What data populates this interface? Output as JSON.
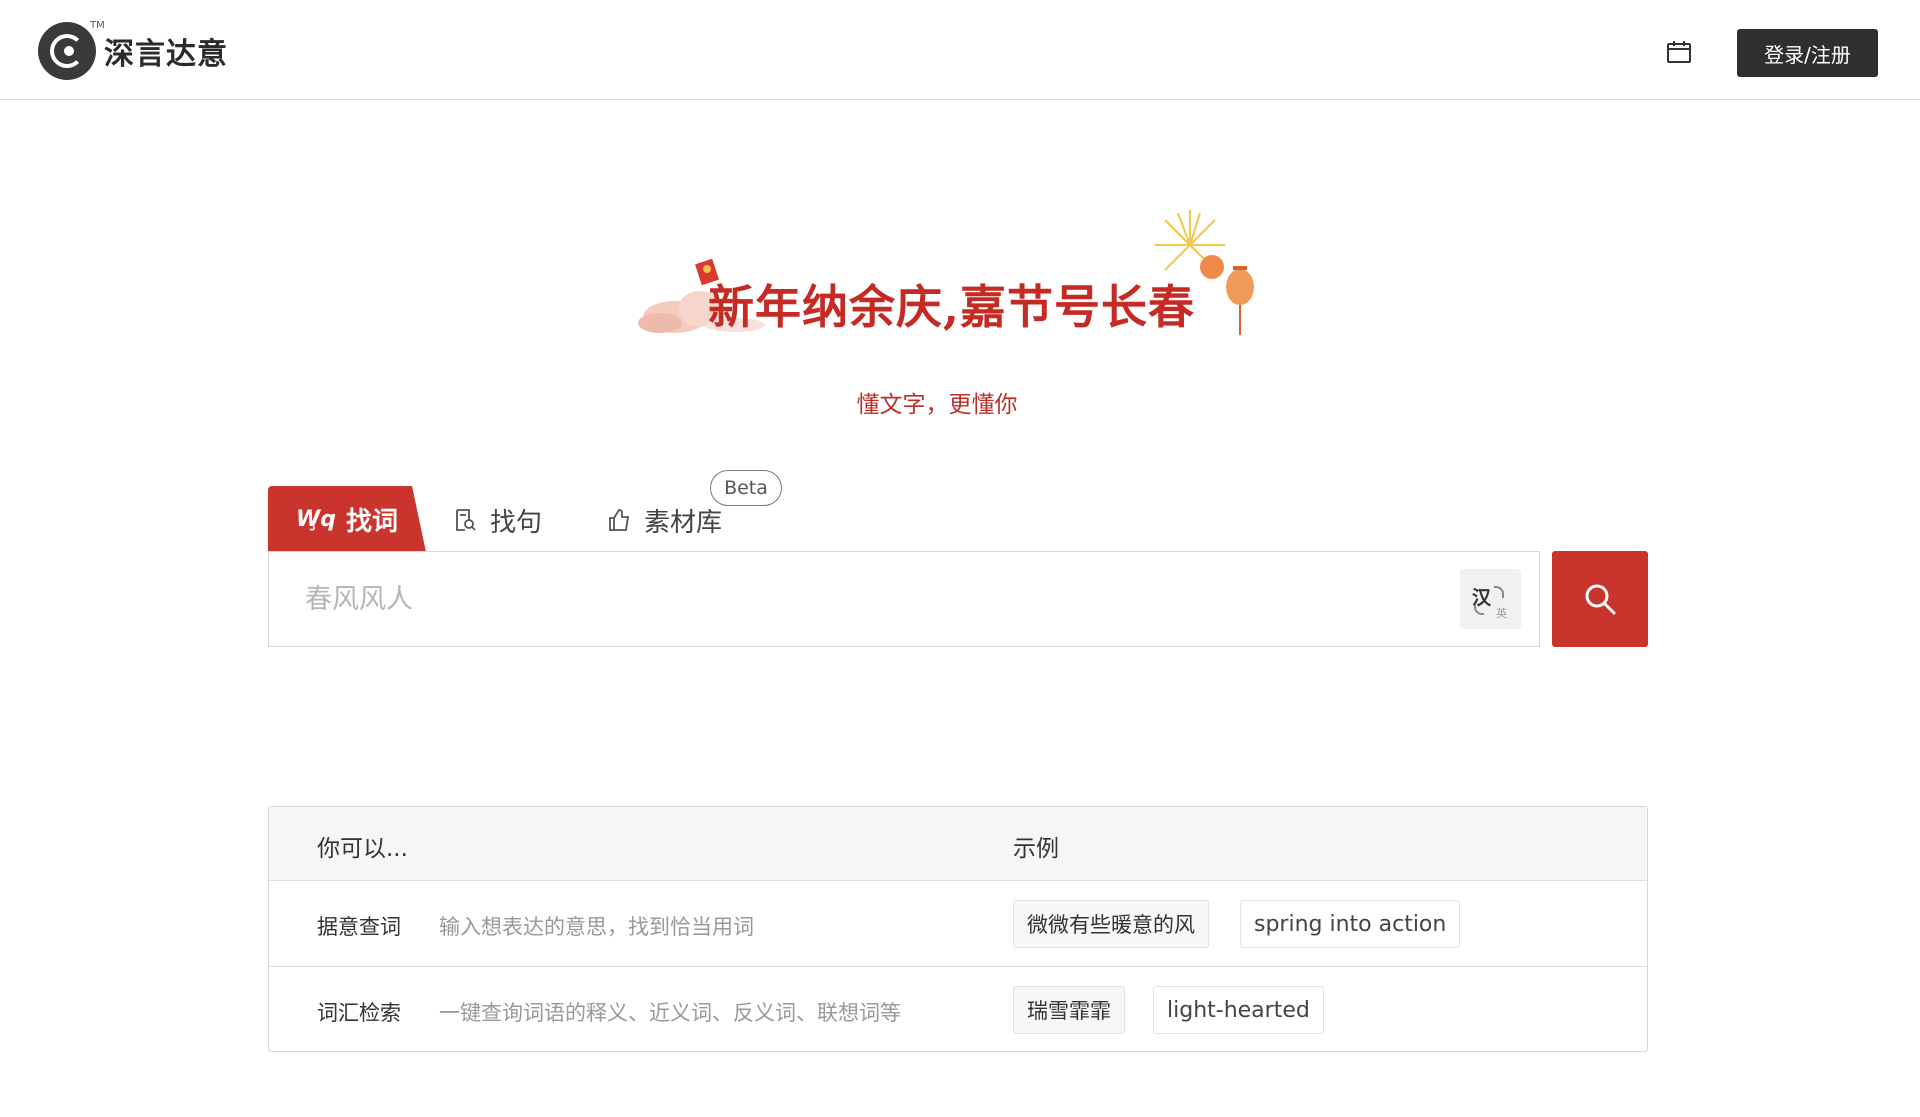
{
  "header": {
    "logo_text": "深言达意",
    "logo_tm": "TM",
    "login_label": "登录/注册",
    "calendar_icon": "calendar-icon"
  },
  "banner": {
    "title": "新年纳余庆,嘉节号长春",
    "tagline": "懂文字，更懂你"
  },
  "tabs": {
    "find_word": {
      "label": "找词",
      "icon": "wq-logo-icon"
    },
    "find_sentence": {
      "label": "找句",
      "icon": "document-search-icon"
    },
    "material": {
      "label": "素材库",
      "icon": "thumb-icon",
      "badge": "Beta"
    }
  },
  "search": {
    "placeholder": "春风风人",
    "lang_zh": "汉",
    "lang_en": "英"
  },
  "table": {
    "head_col1": "你可以...",
    "head_col2": "示例",
    "rows": [
      {
        "name": "据意查词",
        "desc": "输入想表达的意思，找到恰当用词",
        "examples": [
          "微微有些暖意的风",
          "spring into action"
        ]
      },
      {
        "name": "词汇检索",
        "desc": "一键查询词语的释义、近义词、反义词、联想词等",
        "examples": [
          "瑞雪霏霏",
          "light-hearted"
        ]
      }
    ]
  },
  "colors": {
    "brand_red": "#c9342c",
    "dark": "#2f2f2f"
  }
}
